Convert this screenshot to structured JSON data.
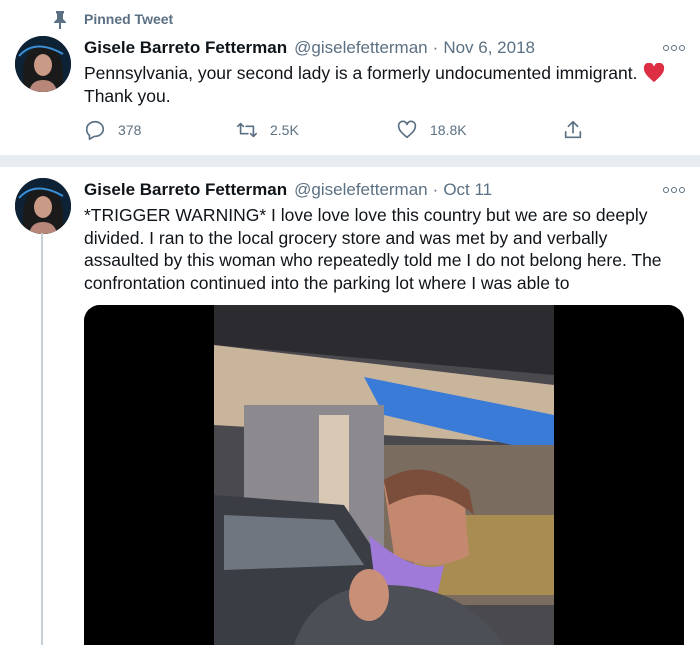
{
  "pinned": {
    "label": "Pinned Tweet",
    "icon": "pin-icon"
  },
  "tweet1": {
    "name": "Gisele Barreto Fetterman",
    "handle": "@giselefetterman",
    "date": "Nov 6, 2018",
    "text_line1": "Pennsylvania, your second lady is a formerly undocumented immigrant.",
    "text_line2": "Thank you.",
    "actions": {
      "reply": "378",
      "retweet": "2.5K",
      "like": "18.8K"
    }
  },
  "tweet2": {
    "name": "Gisele Barreto Fetterman",
    "handle": "@giselefetterman",
    "date": "Oct 11",
    "lines": [
      "*TRIGGER WARNING* I love love love this country but we are so deeply",
      "divided.  I ran to the local grocery store and was met by and verbally",
      "assaulted by this woman who repeatedly told me I do not belong here.  The",
      "confrontation continued into the parking lot where I was able to"
    ]
  },
  "colors": {
    "accent": "#1da1f2",
    "heart": "#e0245e",
    "muted": "#5b7083",
    "divider": "#e6ecf0"
  }
}
